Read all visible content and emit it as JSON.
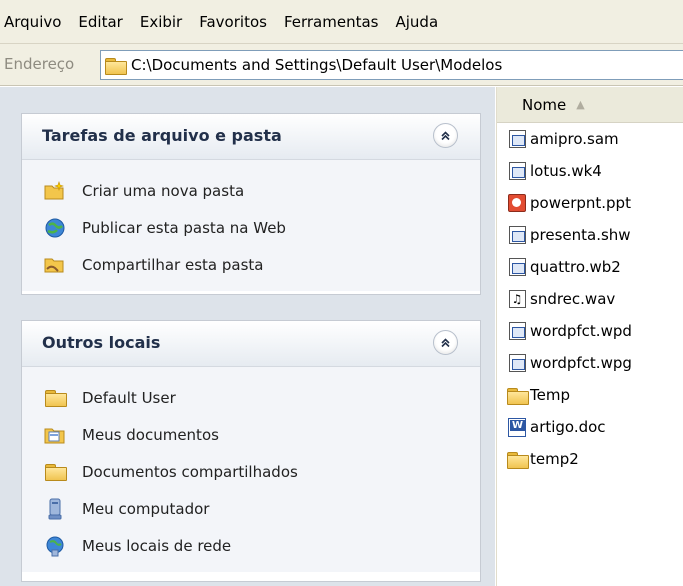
{
  "menubar": {
    "items": [
      "Arquivo",
      "Editar",
      "Exibir",
      "Favoritos",
      "Ferramentas",
      "Ajuda"
    ]
  },
  "address": {
    "label": "Endereço",
    "path": "C:\\Documents and Settings\\Default User\\Modelos"
  },
  "file_tasks": {
    "title": "Tarefas de arquivo e pasta",
    "collapse": "⌃",
    "items": [
      {
        "label": "Criar uma nova pasta",
        "icon": "new-folder-icon"
      },
      {
        "label": "Publicar esta pasta na Web",
        "icon": "publish-web-icon"
      },
      {
        "label": "Compartilhar esta pasta",
        "icon": "share-folder-icon"
      }
    ]
  },
  "other_places": {
    "title": "Outros locais",
    "collapse": "⌃",
    "items": [
      {
        "label": "Default User",
        "icon": "folder-icon"
      },
      {
        "label": "Meus documentos",
        "icon": "my-documents-icon"
      },
      {
        "label": "Documentos compartilhados",
        "icon": "folder-icon"
      },
      {
        "label": "Meu computador",
        "icon": "my-computer-icon"
      },
      {
        "label": "Meus locais de rede",
        "icon": "network-places-icon"
      }
    ]
  },
  "filelist": {
    "column": "Nome",
    "files": [
      {
        "name": "amipro.sam",
        "icon": "document-icon"
      },
      {
        "name": "lotus.wk4",
        "icon": "document-icon"
      },
      {
        "name": "powerpnt.ppt",
        "icon": "powerpoint-icon"
      },
      {
        "name": "presenta.shw",
        "icon": "document-icon"
      },
      {
        "name": "quattro.wb2",
        "icon": "document-icon"
      },
      {
        "name": "sndrec.wav",
        "icon": "audio-icon"
      },
      {
        "name": "wordpfct.wpd",
        "icon": "document-icon"
      },
      {
        "name": "wordpfct.wpg",
        "icon": "document-icon"
      },
      {
        "name": "Temp",
        "icon": "folder-icon"
      },
      {
        "name": "artigo.doc",
        "icon": "word-icon"
      },
      {
        "name": "temp2",
        "icon": "folder-icon"
      }
    ]
  }
}
